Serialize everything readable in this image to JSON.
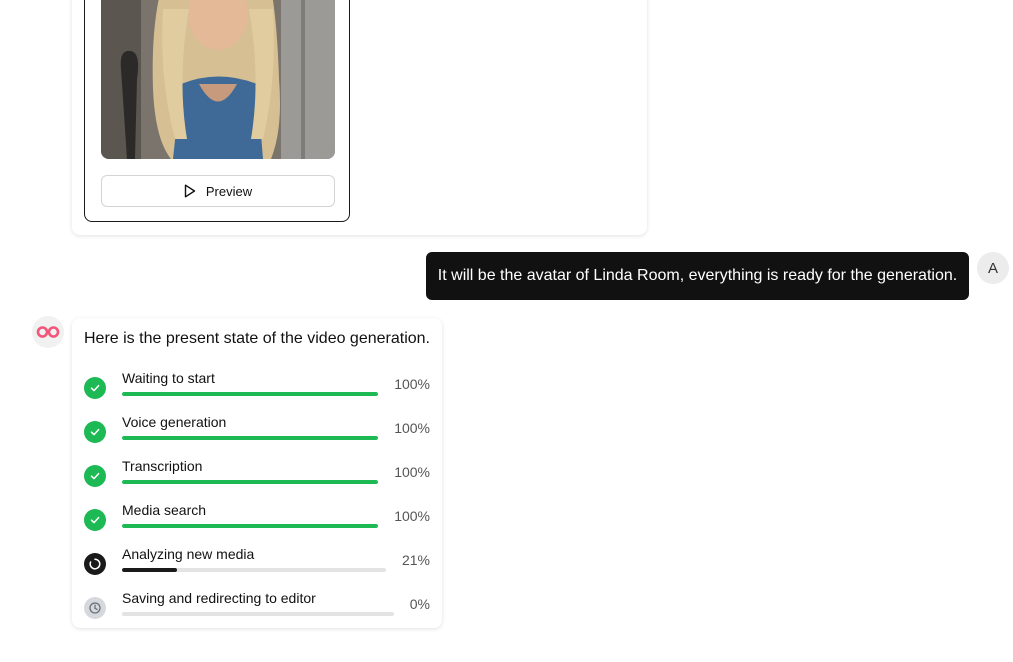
{
  "avatar_card": {
    "preview_label": "Preview"
  },
  "user_message": {
    "text": "It will be the avatar of Linda Room, everything is ready for the generation.",
    "avatar_initial": "A"
  },
  "bot": {
    "logo_icon": "infinity-logo-icon",
    "status_title": "Here is the present state of the video generation.",
    "steps": [
      {
        "label": "Waiting to start",
        "progress": 100,
        "percent_text": "100%",
        "state": "done"
      },
      {
        "label": "Voice generation",
        "progress": 100,
        "percent_text": "100%",
        "state": "done"
      },
      {
        "label": "Transcription",
        "progress": 100,
        "percent_text": "100%",
        "state": "done"
      },
      {
        "label": "Media search",
        "progress": 100,
        "percent_text": "100%",
        "state": "done"
      },
      {
        "label": "Analyzing new media",
        "progress": 21,
        "percent_text": "21%",
        "state": "running"
      },
      {
        "label": "Saving and redirecting to editor",
        "progress": 0,
        "percent_text": "0%",
        "state": "pending"
      }
    ]
  },
  "colors": {
    "done": "#1db954",
    "running": "#1a1a1a",
    "pending": "#d5d8dc",
    "logo": "#f2557a"
  }
}
